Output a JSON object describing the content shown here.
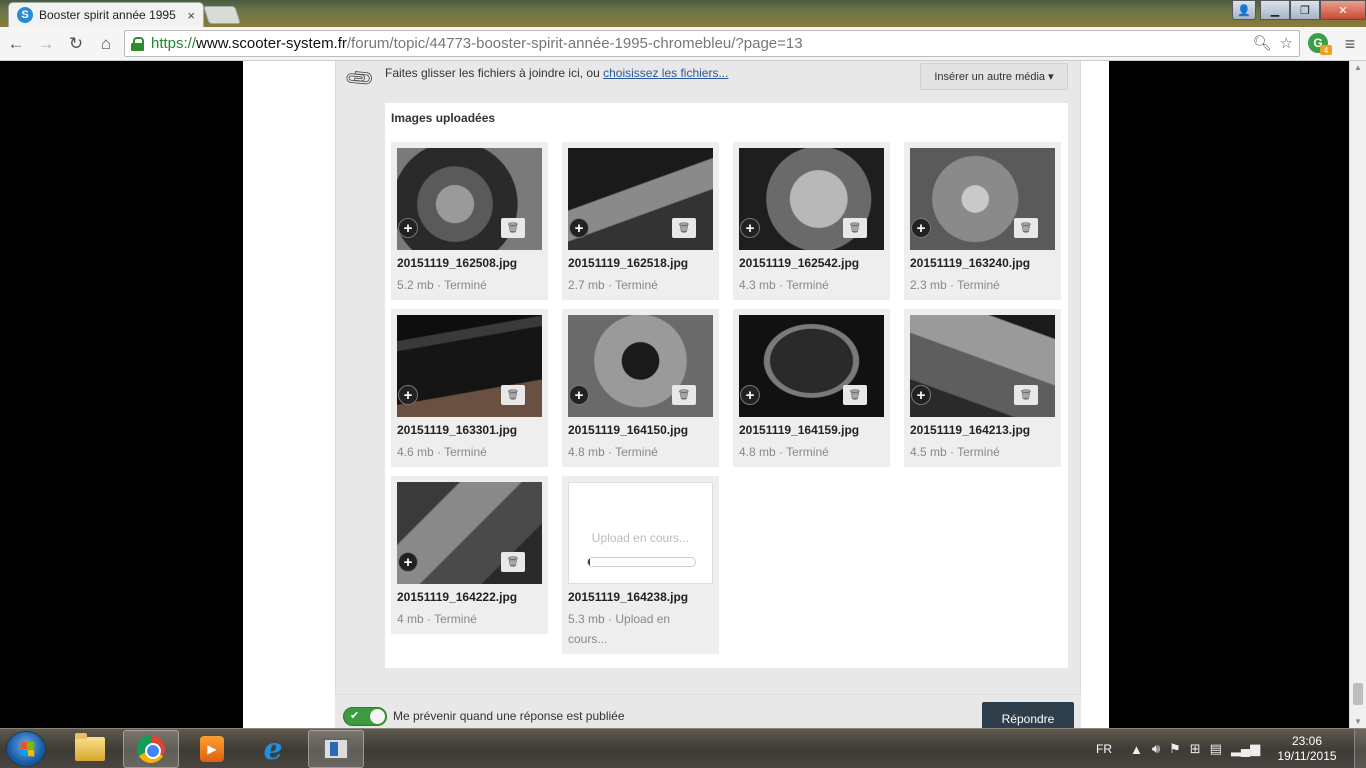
{
  "browser": {
    "tab_title": "Booster spirit année 1995",
    "tab_close": "×",
    "url_scheme": "https://",
    "url_host": "www.scooter-system.fr",
    "url_path": "/forum/topic/44773-booster-spirit-année-1995-chromebleu/?page=13",
    "ext_badge": "4",
    "ext_letter": "G"
  },
  "editor": {
    "attach_text": "Faites glisser les fichiers à joindre ici, ou ",
    "attach_link": "choisissez les fichiers...",
    "insert_media": "Insérer un autre média ▾",
    "uploads_title": "Images uploadées"
  },
  "uploads": [
    {
      "name": "20151119_162508.jpg",
      "meta": "5.2 mb · Terminé"
    },
    {
      "name": "20151119_162518.jpg",
      "meta": "2.7 mb · Terminé"
    },
    {
      "name": "20151119_162542.jpg",
      "meta": "4.3 mb · Terminé"
    },
    {
      "name": "20151119_163240.jpg",
      "meta": "2.3 mb · Terminé"
    },
    {
      "name": "20151119_163301.jpg",
      "meta": "4.6 mb · Terminé"
    },
    {
      "name": "20151119_164150.jpg",
      "meta": "4.8 mb · Terminé"
    },
    {
      "name": "20151119_164159.jpg",
      "meta": "4.8 mb · Terminé"
    },
    {
      "name": "20151119_164213.jpg",
      "meta": "4.5 mb · Terminé"
    },
    {
      "name": "20151119_164222.jpg",
      "meta": "4 mb · Terminé"
    }
  ],
  "pending_upload": {
    "label": "Upload en cours...",
    "name": "20151119_164238.jpg",
    "meta": "5.3 mb · Upload en cours...",
    "progress": 0.01
  },
  "footer": {
    "notify_label": "Me prévenir quand une réponse est publiée",
    "notify_enabled": true,
    "reply_button": "Répondre"
  },
  "taskbar": {
    "language": "FR",
    "time": "23:06",
    "date": "19/11/2015"
  },
  "colors": {
    "toggle_on": "#3e9a3e",
    "reply_button": "#2e3e4a",
    "link": "#2a5a9a"
  }
}
